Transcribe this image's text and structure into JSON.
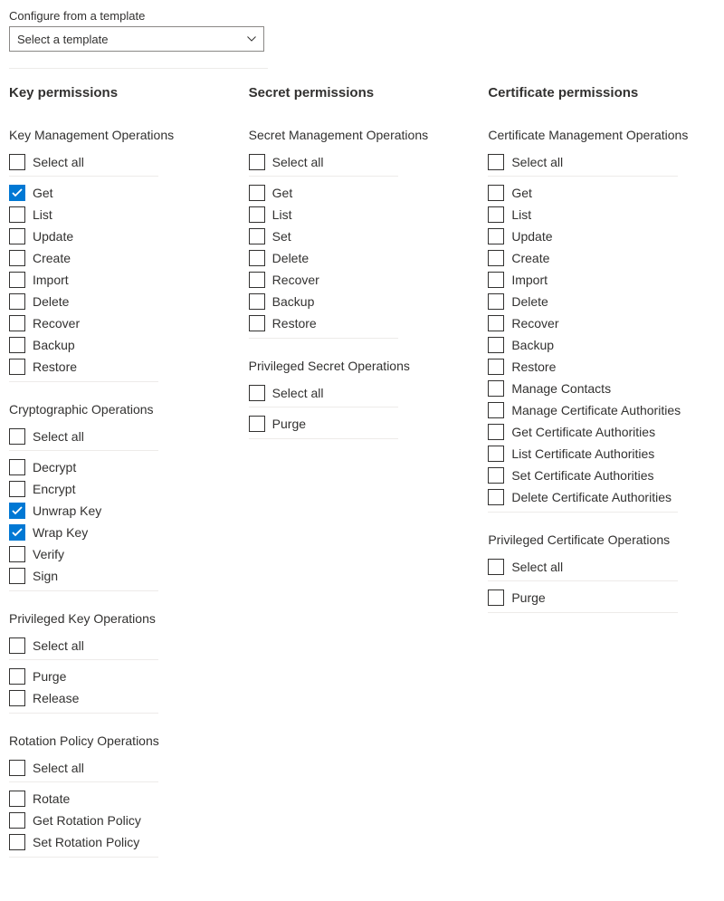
{
  "template": {
    "label": "Configure from a template",
    "selected": "Select a template"
  },
  "selectAllLabel": "Select all",
  "columns": [
    {
      "heading": "Key permissions",
      "wide": false,
      "groups": [
        {
          "title": "Key Management Operations",
          "items": [
            {
              "label": "Get",
              "checked": true
            },
            {
              "label": "List",
              "checked": false
            },
            {
              "label": "Update",
              "checked": false
            },
            {
              "label": "Create",
              "checked": false
            },
            {
              "label": "Import",
              "checked": false
            },
            {
              "label": "Delete",
              "checked": false
            },
            {
              "label": "Recover",
              "checked": false
            },
            {
              "label": "Backup",
              "checked": false
            },
            {
              "label": "Restore",
              "checked": false
            }
          ]
        },
        {
          "title": "Cryptographic Operations",
          "items": [
            {
              "label": "Decrypt",
              "checked": false
            },
            {
              "label": "Encrypt",
              "checked": false
            },
            {
              "label": "Unwrap Key",
              "checked": true
            },
            {
              "label": "Wrap Key",
              "checked": true
            },
            {
              "label": "Verify",
              "checked": false
            },
            {
              "label": "Sign",
              "checked": false
            }
          ]
        },
        {
          "title": "Privileged Key Operations",
          "items": [
            {
              "label": "Purge",
              "checked": false
            },
            {
              "label": "Release",
              "checked": false
            }
          ]
        },
        {
          "title": "Rotation Policy Operations",
          "items": [
            {
              "label": "Rotate",
              "checked": false
            },
            {
              "label": "Get Rotation Policy",
              "checked": false
            },
            {
              "label": "Set Rotation Policy",
              "checked": false
            }
          ]
        }
      ]
    },
    {
      "heading": "Secret permissions",
      "wide": false,
      "groups": [
        {
          "title": "Secret Management Operations",
          "items": [
            {
              "label": "Get",
              "checked": false
            },
            {
              "label": "List",
              "checked": false
            },
            {
              "label": "Set",
              "checked": false
            },
            {
              "label": "Delete",
              "checked": false
            },
            {
              "label": "Recover",
              "checked": false
            },
            {
              "label": "Backup",
              "checked": false
            },
            {
              "label": "Restore",
              "checked": false
            }
          ]
        },
        {
          "title": "Privileged Secret Operations",
          "items": [
            {
              "label": "Purge",
              "checked": false
            }
          ]
        }
      ]
    },
    {
      "heading": "Certificate permissions",
      "wide": true,
      "groups": [
        {
          "title": "Certificate Management Operations",
          "items": [
            {
              "label": "Get",
              "checked": false
            },
            {
              "label": "List",
              "checked": false
            },
            {
              "label": "Update",
              "checked": false
            },
            {
              "label": "Create",
              "checked": false
            },
            {
              "label": "Import",
              "checked": false
            },
            {
              "label": "Delete",
              "checked": false
            },
            {
              "label": "Recover",
              "checked": false
            },
            {
              "label": "Backup",
              "checked": false
            },
            {
              "label": "Restore",
              "checked": false
            },
            {
              "label": "Manage Contacts",
              "checked": false
            },
            {
              "label": "Manage Certificate Authorities",
              "checked": false
            },
            {
              "label": "Get Certificate Authorities",
              "checked": false
            },
            {
              "label": "List Certificate Authorities",
              "checked": false
            },
            {
              "label": "Set Certificate Authorities",
              "checked": false
            },
            {
              "label": "Delete Certificate Authorities",
              "checked": false
            }
          ]
        },
        {
          "title": "Privileged Certificate Operations",
          "items": [
            {
              "label": "Purge",
              "checked": false
            }
          ]
        }
      ]
    }
  ]
}
